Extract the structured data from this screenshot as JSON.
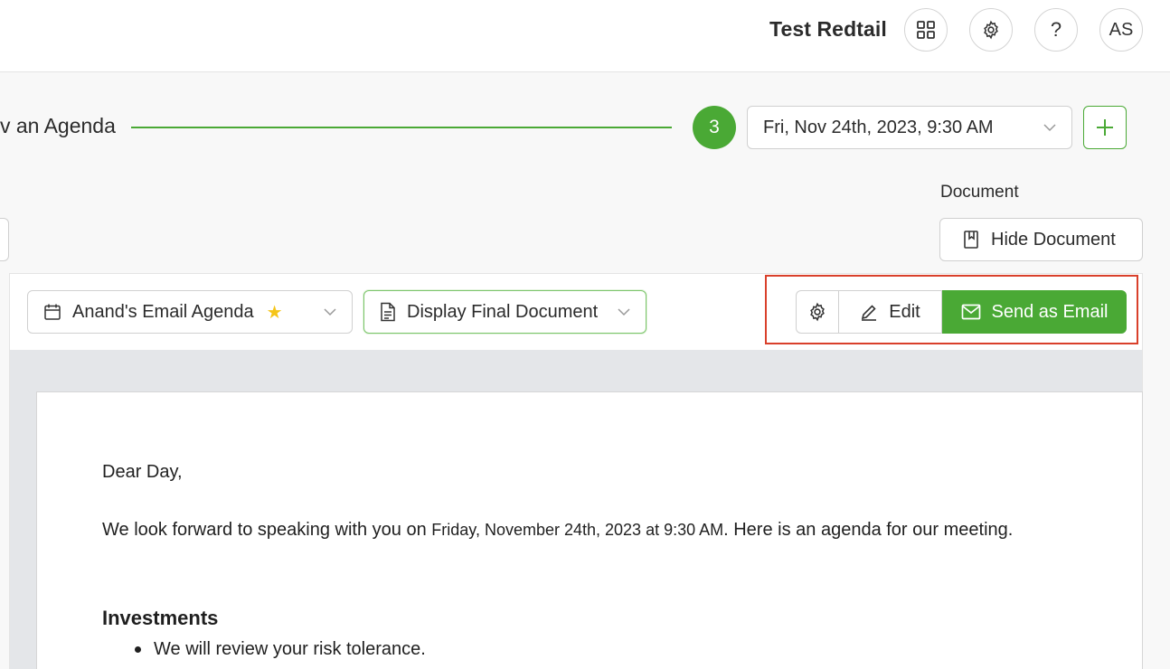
{
  "header": {
    "org_name": "Test Redtail",
    "avatar_initials": "AS",
    "help_label": "?"
  },
  "stepper": {
    "step_title": "v an Agenda",
    "step_number": "3",
    "meeting_date": "Fri, Nov 24th, 2023, 9:30 AM"
  },
  "document_section": {
    "label": "Document",
    "hide_button_label": "Hide Document"
  },
  "toolbar": {
    "agenda_select_value": "Anand's Email Agenda",
    "display_select_value": "Display Final Document",
    "edit_label": "Edit",
    "send_label": "Send as Email"
  },
  "document": {
    "greeting": "Dear Day,",
    "para_part1": "We look forward to speaking with you on ",
    "para_date": "Friday, November 24th, 2023 at 9:30 AM",
    "para_part2": ". Here is an agenda for our meeting.",
    "section_heading": "Investments",
    "bullets": [
      "We will review your risk tolerance."
    ]
  },
  "colors": {
    "accent_green": "#4aa935",
    "highlight_red": "#d9402b",
    "star_yellow": "#f5c518"
  },
  "icons": [
    "apps-grid-icon",
    "gear-icon",
    "help-icon",
    "chevron-down-icon",
    "plus-icon",
    "book-icon",
    "calendar-icon",
    "star-icon",
    "document-icon",
    "pencil-icon",
    "mail-icon"
  ]
}
